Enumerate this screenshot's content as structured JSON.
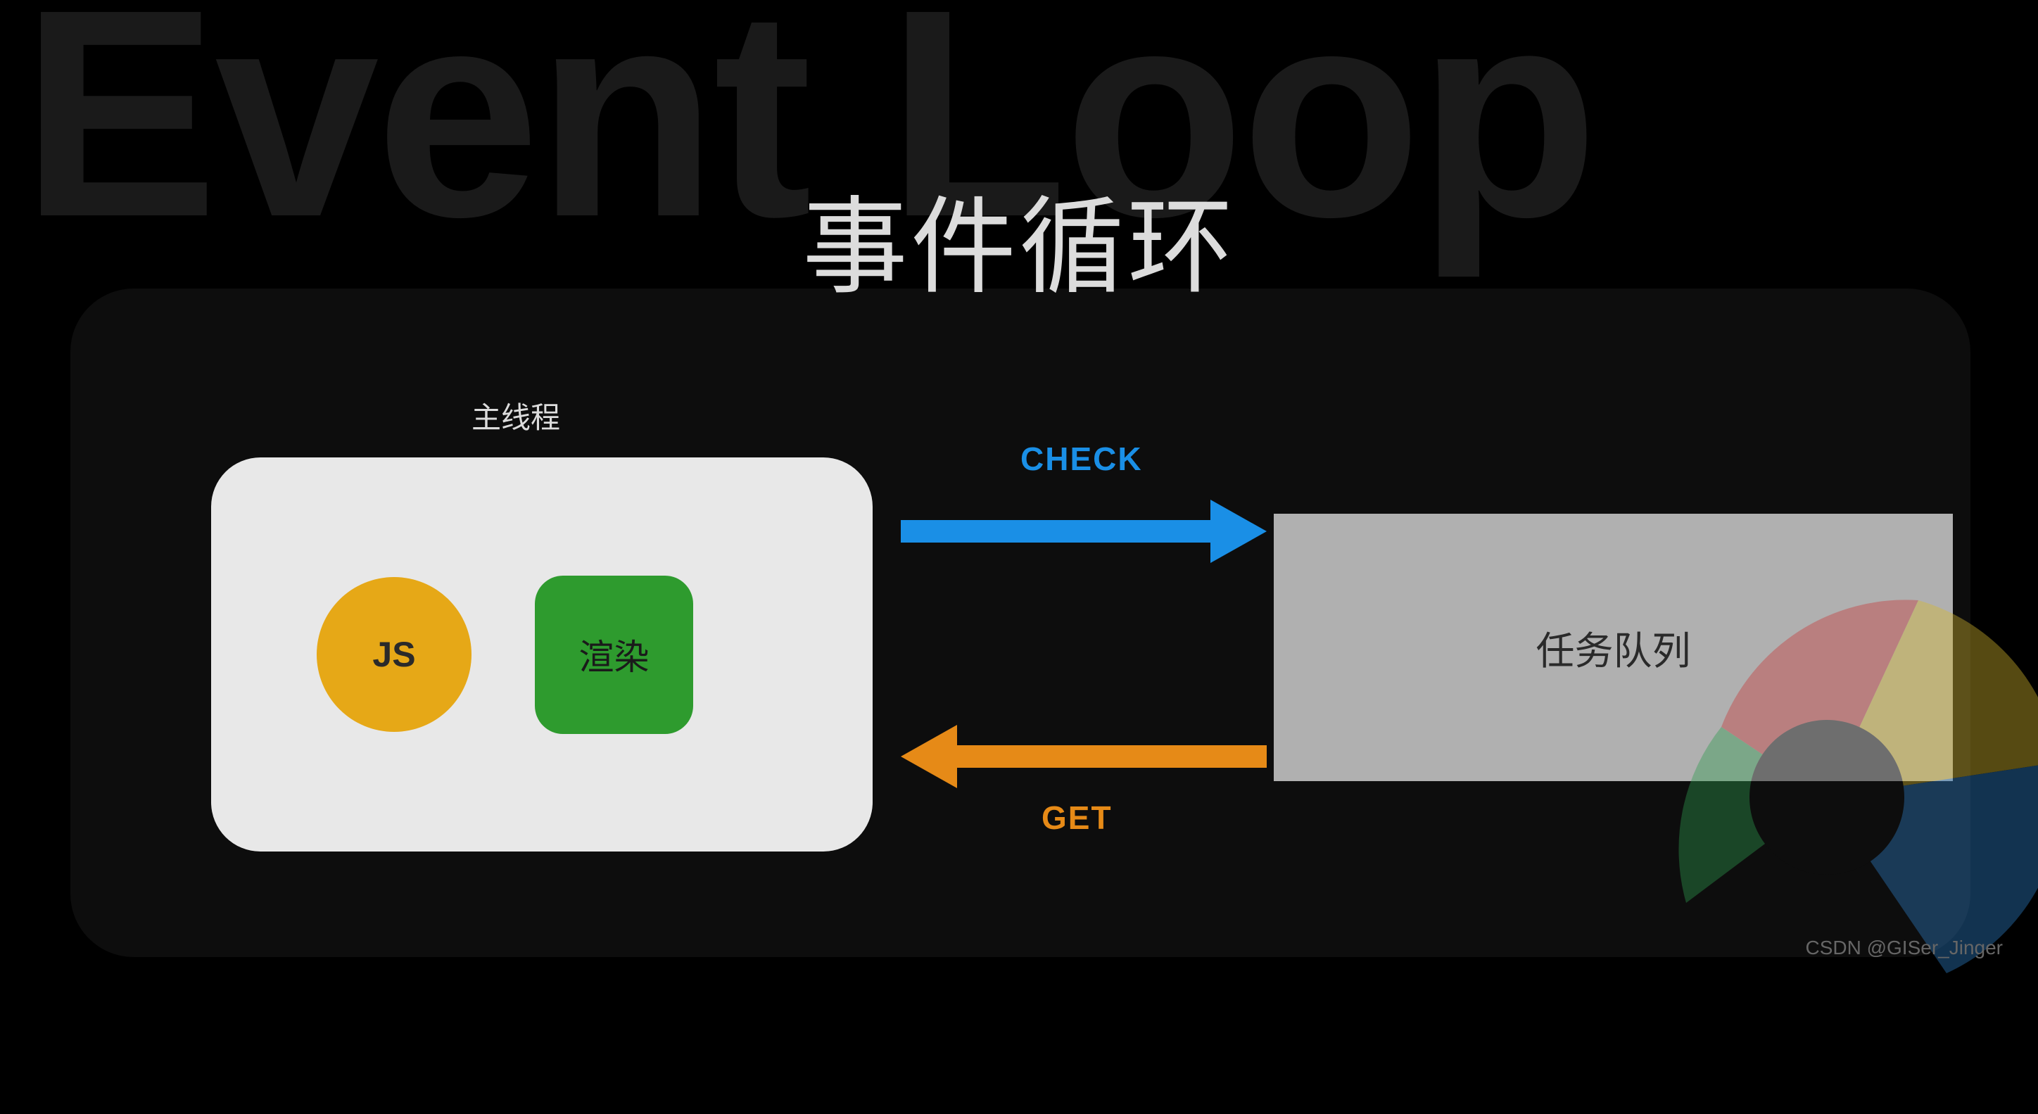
{
  "background_text": "Event Loop",
  "main_title": "事件循环",
  "main_thread": {
    "label": "主线程",
    "js_label": "JS",
    "render_label": "渲染"
  },
  "task_queue": {
    "label": "任务队列"
  },
  "arrows": {
    "check_label": "CHECK",
    "get_label": "GET",
    "check_color": "#1a8fe6",
    "get_color": "#e68a17"
  },
  "watermark": "CSDN @GISer_Jinger",
  "colors": {
    "js_circle": "#e6a817",
    "render_box": "#2e9b2e",
    "task_queue_bg": "#b0b0b0",
    "main_thread_bg": "#e8e8e8"
  }
}
